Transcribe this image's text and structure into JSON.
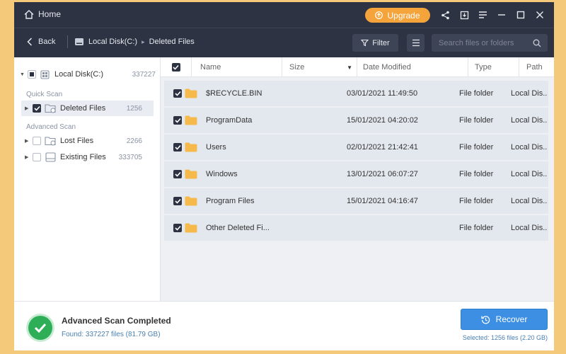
{
  "titlebar": {
    "home_label": "Home",
    "upgrade_label": "Upgrade"
  },
  "navbar": {
    "back_label": "Back",
    "breadcrumb": [
      "Local Disk(C:)",
      "Deleted Files"
    ],
    "filter_label": "Filter",
    "search_placeholder": "Search files or folders"
  },
  "sidebar": {
    "root": {
      "label": "Local Disk(C:)",
      "count": "337227"
    },
    "quick_scan_label": "Quick Scan",
    "advanced_scan_label": "Advanced Scan",
    "items": [
      {
        "label": "Deleted Files",
        "count": "1256"
      },
      {
        "label": "Lost Files",
        "count": "2266"
      },
      {
        "label": "Existing Files",
        "count": "333705"
      }
    ]
  },
  "table": {
    "columns": [
      "Name",
      "Size",
      "Date Modified",
      "Type",
      "Path"
    ],
    "rows": [
      {
        "name": "$RECYCLE.BIN",
        "size": "",
        "date": "03/01/2021 11:49:50",
        "type": "File folder",
        "path": "Local Dis..."
      },
      {
        "name": "ProgramData",
        "size": "",
        "date": "15/01/2021 04:20:02",
        "type": "File folder",
        "path": "Local Dis..."
      },
      {
        "name": "Users",
        "size": "",
        "date": "02/01/2021 21:42:41",
        "type": "File folder",
        "path": "Local Dis..."
      },
      {
        "name": "Windows",
        "size": "",
        "date": "13/01/2021 06:07:27",
        "type": "File folder",
        "path": "Local Dis..."
      },
      {
        "name": "Program Files",
        "size": "",
        "date": "15/01/2021 04:16:47",
        "type": "File folder",
        "path": "Local Dis..."
      },
      {
        "name": "Other Deleted Fi...",
        "size": "",
        "date": "",
        "type": "File folder",
        "path": "Local Dis..."
      }
    ]
  },
  "footer": {
    "status_title": "Advanced Scan Completed",
    "status_detail": "Found: 337227 files (81.79 GB)",
    "recover_label": "Recover",
    "selected_info": "Selected: 1256 files (2.20 GB)"
  },
  "colors": {
    "accent": "#3d8fe3",
    "upgrade": "#f5a33b",
    "titlebar": "#2d3342",
    "success": "#2fae58",
    "folder": "#f5b94c"
  }
}
